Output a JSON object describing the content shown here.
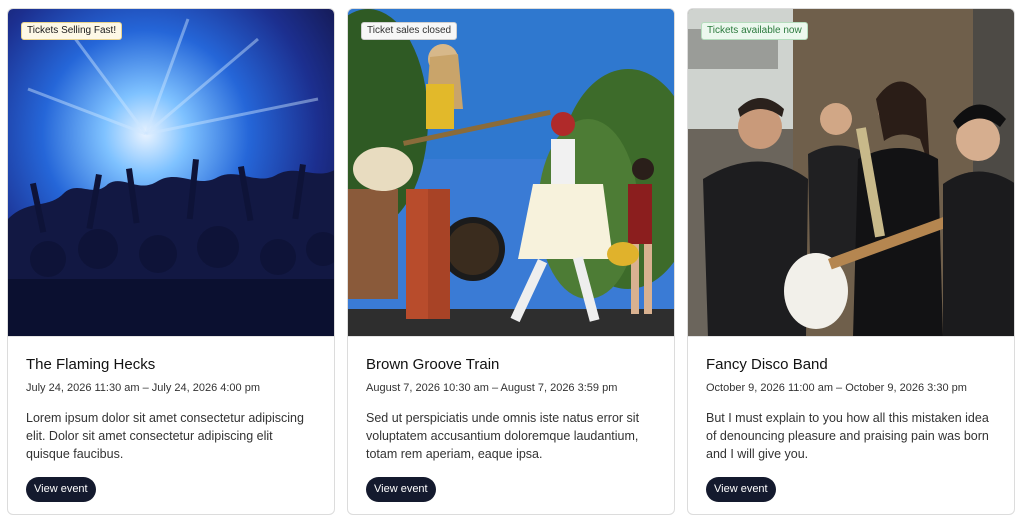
{
  "events": [
    {
      "badge": "Tickets Selling Fast!",
      "title": "The Flaming Hecks",
      "dates": "July 24, 2026 11:30 am – July 24, 2026 4:00 pm",
      "description": "Lorem ipsum dolor sit amet consectetur adipiscing elit. Dolor sit amet consectetur adipiscing elit quisque faucibus.",
      "button": "View event"
    },
    {
      "badge": "Ticket sales closed",
      "title": "Brown Groove Train",
      "dates": "August 7, 2026 10:30 am – August 7, 2026 3:59 pm",
      "description": "Sed ut perspiciatis unde omnis iste natus error sit voluptatem accusantium doloremque laudantium, totam rem aperiam, eaque ipsa.",
      "button": "View event"
    },
    {
      "badge": "Tickets available now",
      "title": "Fancy Disco Band",
      "dates": "October 9, 2026 11:00 am – October 9, 2026 3:30 pm",
      "description": "But I must explain to you how all this mistaken idea of denouncing pleasure and praising pain was born and I will give you.",
      "button": "View event"
    }
  ],
  "colors": {
    "button_bg": "#141a2e",
    "badge_fast_bg": "#fdf8e6",
    "badge_available_text": "#2b7a3d"
  }
}
